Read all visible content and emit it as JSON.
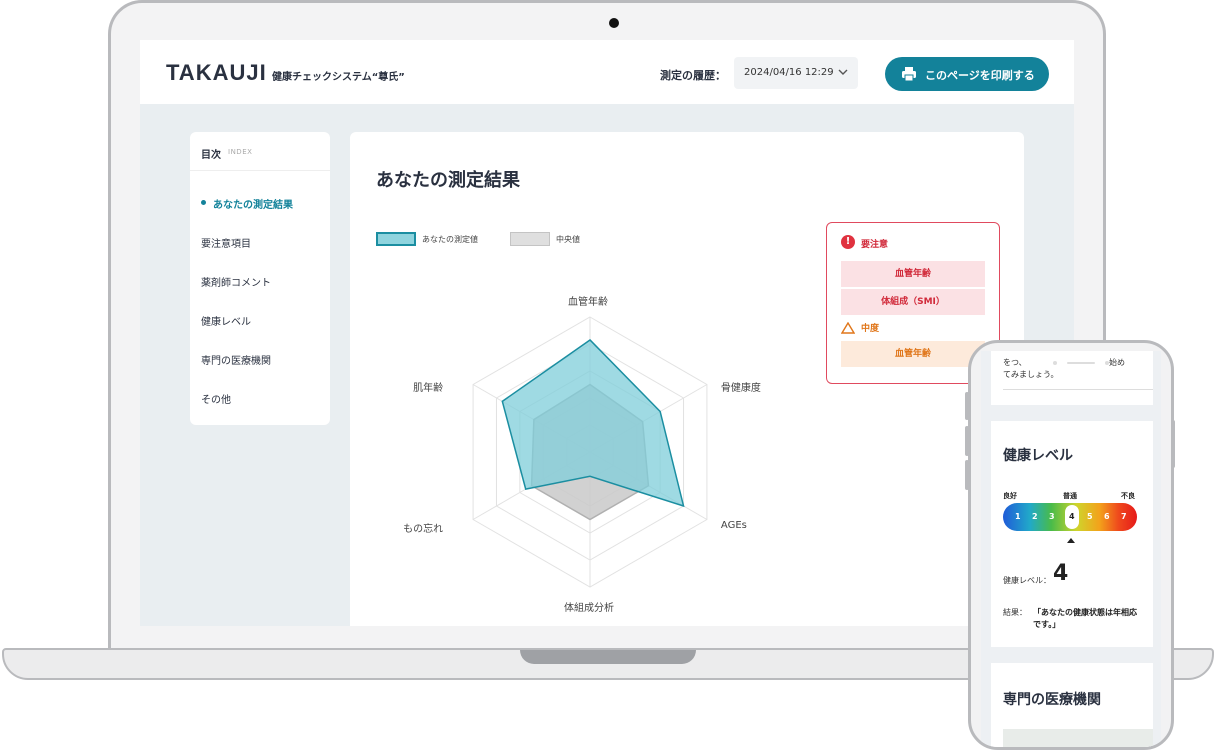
{
  "app": {
    "brand": "TAKAUJI",
    "subtitle": "健康チェックシステム“尊氏”",
    "history_label": "測定の履歴：",
    "history_value": "2024/04/16 12:29",
    "print_label": "このページを印刷する"
  },
  "index": {
    "title": "目次",
    "subtitle": "INDEX",
    "items": [
      {
        "label": "あなたの測定結果"
      },
      {
        "label": "要注意項目"
      },
      {
        "label": "薬剤師コメント"
      },
      {
        "label": "健康レベル"
      },
      {
        "label": "専門の医療機関"
      },
      {
        "label": "その他"
      }
    ]
  },
  "main": {
    "title": "あなたの測定結果",
    "legend_you": "あなたの測定値",
    "legend_median": "中央値"
  },
  "chart_data": {
    "type": "radar",
    "categories": [
      "血管年齢",
      "骨健康度",
      "AGEs",
      "体組成分析",
      "もの忘れ",
      "肌年齢"
    ],
    "max": 1.0,
    "series": [
      {
        "name": "あなたの測定値",
        "values": [
          0.83,
          0.6,
          0.8,
          0.18,
          0.55,
          0.75
        ],
        "color": "#7fcdd9",
        "stroke": "#1b8ea1"
      },
      {
        "name": "中央値",
        "values": [
          0.5,
          0.45,
          0.5,
          0.5,
          0.5,
          0.48
        ],
        "color": "#c9c9c9",
        "stroke": "#b0b0b0"
      }
    ],
    "rings": 5
  },
  "alerts": {
    "warning_label": "要注意",
    "warning_items": [
      "血管年齢",
      "体組成（SMI）"
    ],
    "moderate_label": "中度",
    "moderate_items": [
      "血管年齢"
    ],
    "warning_color": "#d12a3a",
    "moderate_color": "#e0761a"
  },
  "phone": {
    "top_text": "をつ、",
    "top_text_right": "始め",
    "top_text2": "てみましょう。",
    "health_title": "健康レベル",
    "scale_left": "良好",
    "scale_mid": "普通",
    "scale_right": "不良",
    "scale_numbers": [
      "1",
      "2",
      "3",
      "4",
      "5",
      "6",
      "7"
    ],
    "selected_level": "4",
    "level_label": "健康レベル：",
    "level_value": "4",
    "result_label": "結果：",
    "result_value": "「あなたの健康状態は年相応です。」",
    "clinic_title": "専門の医療機関"
  },
  "colors": {
    "accent": "#13829a",
    "text_dark": "#2a3140"
  }
}
